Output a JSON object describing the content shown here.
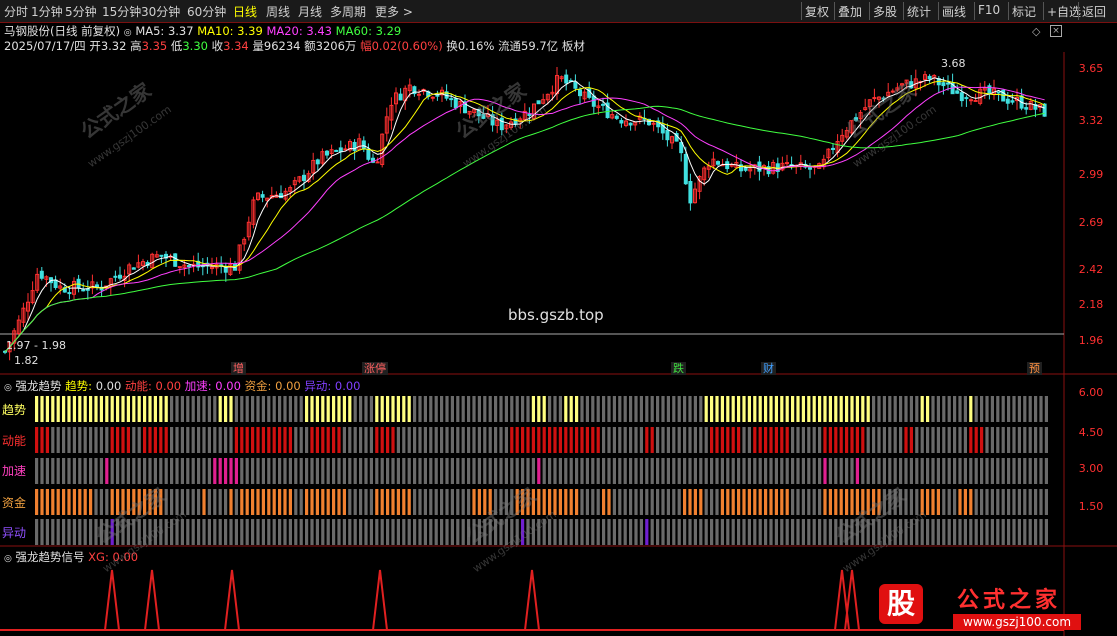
{
  "toolbar": {
    "periods": [
      "分时",
      "1分钟",
      "5分钟",
      "15分钟",
      "30分钟",
      "60分钟",
      "日线",
      "周线",
      "月线",
      "多周期",
      "更多 >"
    ],
    "active_period": "日线",
    "right_buttons": [
      "复权",
      "叠加",
      "多股",
      "统计",
      "画线",
      "F10",
      "标记",
      "+自选",
      "返回"
    ]
  },
  "stock": {
    "name": "马钢股份",
    "mode": "(日线 前复权)",
    "ma5": "MA5: 3.37",
    "ma10": "MA10: 3.39",
    "ma20": "MA20: 3.43",
    "ma60": "MA60: 3.29",
    "date": "2025/07/17/四",
    "open_l": "开",
    "open": "3.32",
    "high_l": "高",
    "high": "3.35",
    "low_l": "低",
    "low": "3.30",
    "close_l": "收",
    "close": "3.34",
    "vol_l": "量",
    "vol": "96234",
    "amt_l": "额",
    "amt": "3206万",
    "chg_l": "幅",
    "chg": "0.02(0.60%)",
    "turn": "换0.16%",
    "float": "流通59.7亿",
    "board": "板材"
  },
  "main_axis": [
    "3.65",
    "3.32",
    "2.99",
    "2.69",
    "2.42",
    "2.18",
    "1.96"
  ],
  "annotations": {
    "high": "3.68",
    "low": "1.82",
    "range": "1.97 - 1.98"
  },
  "watermark_center": "bbs.gszb.top",
  "watermark": {
    "name": "公式之家",
    "url": "www.gszj100.com"
  },
  "event_tags": [
    {
      "label": "增",
      "color": "#ff6060"
    },
    {
      "label": "涨停",
      "color": "#ff6060"
    },
    {
      "label": "跌",
      "color": "#40e040"
    },
    {
      "label": "财",
      "color": "#40a0ff"
    },
    {
      "label": "预",
      "color": "#ff9040"
    }
  ],
  "indicator1": {
    "title": "强龙趋势",
    "trend_l": "趋势:",
    "trend": "0.00",
    "momentum_l": "动能:",
    "momentum": "0.00",
    "accel_l": "加速:",
    "accel": "0.00",
    "capital_l": "资金:",
    "capital": "0.00",
    "abnormal_l": "异动:",
    "abnormal": "0.00",
    "rows": [
      "趋势",
      "动能",
      "加速",
      "资金",
      "异动"
    ],
    "axis": [
      "6.00",
      "4.50",
      "3.00",
      "1.50"
    ]
  },
  "indicator2": {
    "title": "强龙趋势信号",
    "xg": "XG: 0.00"
  },
  "logo": {
    "badge": "股",
    "name": "公式之家",
    "url": "www.gszj100.com"
  },
  "colors": {
    "up": "#ff3030",
    "down": "#40e0e0",
    "ma5": "#ffffff",
    "ma10": "#ffff00",
    "ma20": "#ff40ff",
    "ma60": "#40ff40",
    "trend": "#ffff80",
    "momentum": "#d01010",
    "accel": "#e02090",
    "capital": "#f08030",
    "abnormal": "#7020d0",
    "inactive": "#6a6a6a"
  }
}
